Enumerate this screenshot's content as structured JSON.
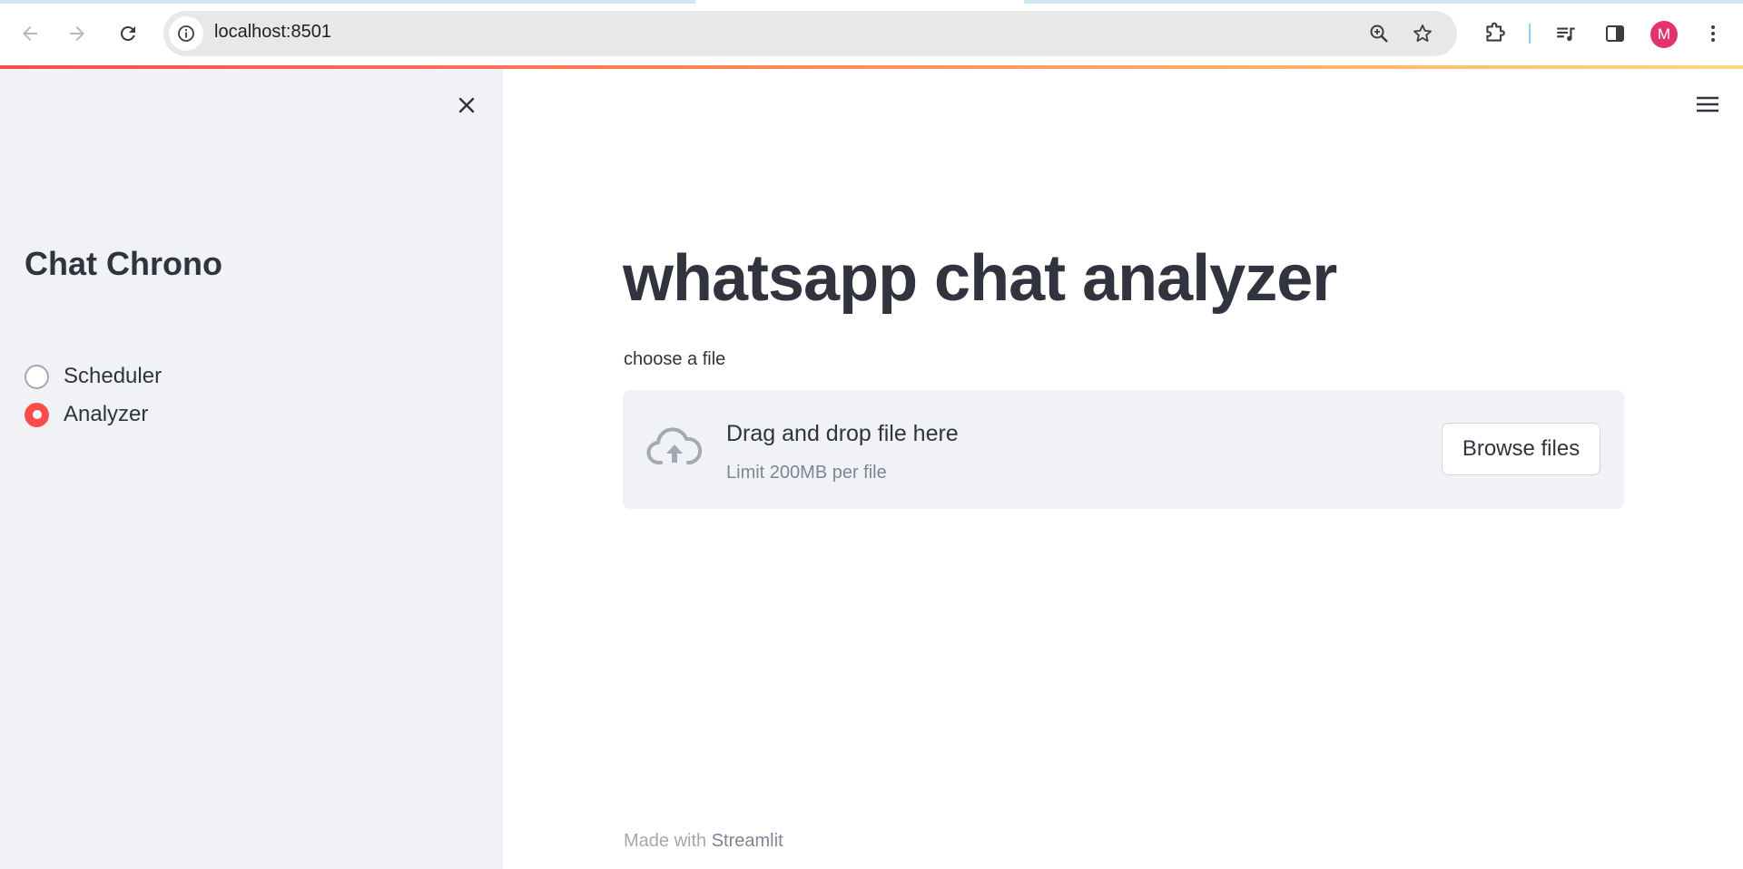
{
  "browser": {
    "url": "localhost:8501",
    "avatar_letter": "M",
    "avatar_color": "#e5326f"
  },
  "theme": {
    "primary": "#ff4b4b",
    "sidebar_bg": "#f0f2f6",
    "text": "#31333f"
  },
  "sidebar": {
    "title": "Chat Chrono",
    "radio_options": [
      {
        "label": "Scheduler",
        "selected": false
      },
      {
        "label": "Analyzer",
        "selected": true
      }
    ]
  },
  "main": {
    "title": "whatsapp chat analyzer",
    "uploader": {
      "label": "choose a file",
      "drop_text": "Drag and drop file here",
      "limit_text": "Limit 200MB per file",
      "browse_label": "Browse files"
    }
  },
  "footer": {
    "prefix": "Made with",
    "brand": "Streamlit"
  }
}
